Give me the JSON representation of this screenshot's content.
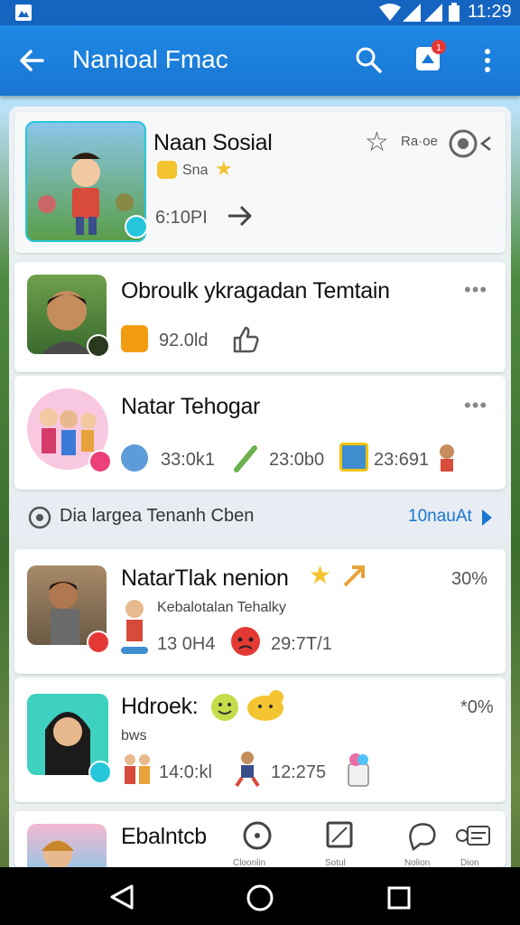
{
  "status": {
    "time": "11:29"
  },
  "appbar": {
    "title": "Nanioal Fmac"
  },
  "featured": {
    "title": "Naan Sosial",
    "badge_label": "Sna",
    "side_label": "Ra·oe",
    "meta": "6:10PI"
  },
  "items": [
    {
      "title": "Obroulk ykragadan Temtain",
      "stat1": "92.0ld"
    },
    {
      "title": "Natar Tehogar",
      "stat1": "33:0k1",
      "stat2": "23:0b0",
      "stat3": "23:691"
    }
  ],
  "section": {
    "title": "Dia largea Tenanh Cben",
    "action": "10nauAt"
  },
  "items2": [
    {
      "title": "NatarTlak nenion",
      "percent": "30%",
      "subtitle": "Kebalotalan Tehalky",
      "stat1": "13 0H4",
      "stat2": "29:7T/1"
    },
    {
      "title": "Hdroek:",
      "percent": "*0%",
      "subtitle": "bws",
      "stat1": "14:0:kl",
      "stat2": "12:275"
    },
    {
      "title": "Ebalntcb"
    }
  ],
  "bottom_tabs": [
    {
      "icon": "circle-icon",
      "label": "Cloonlin"
    },
    {
      "icon": "image-icon",
      "label": "Sotul"
    },
    {
      "icon": "chat-icon",
      "label": "Nolion"
    },
    {
      "icon": "card-icon",
      "label": "Dion"
    }
  ],
  "colors": {
    "appbar": "#1976d2",
    "accent": "#1e88e5",
    "badge": "#e53935",
    "online": "#26c6da"
  }
}
